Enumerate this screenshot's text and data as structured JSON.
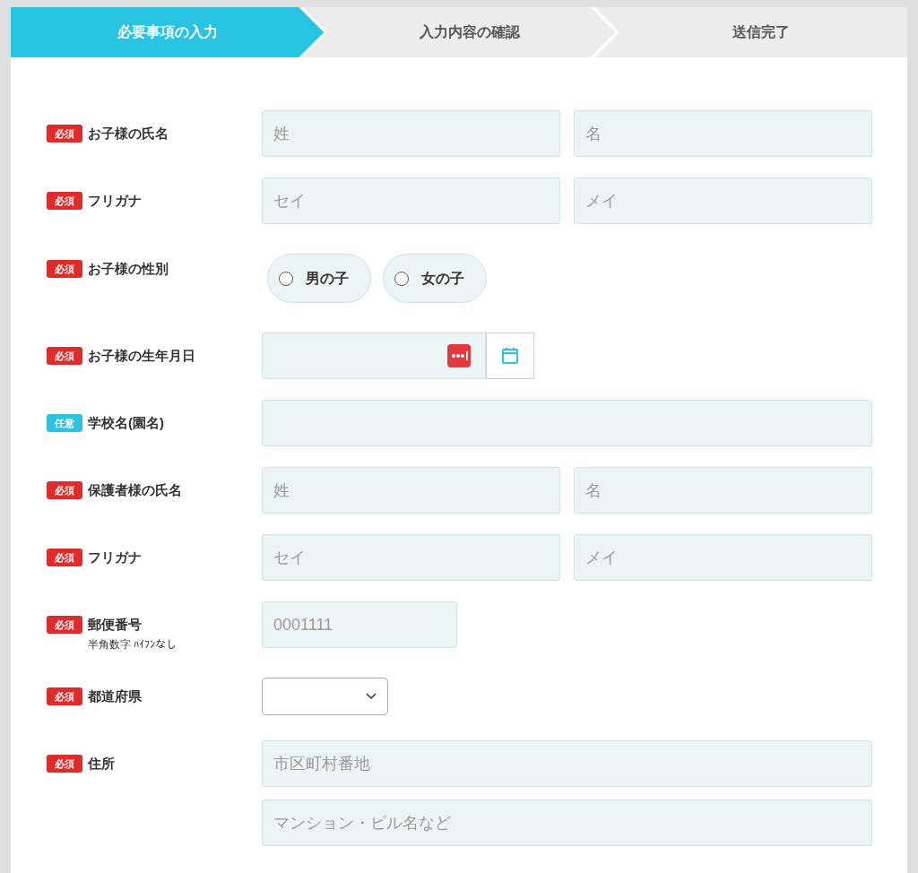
{
  "steps": [
    {
      "label": "必要事項の入力",
      "selected": true
    },
    {
      "label": "入力内容の確認",
      "selected": false
    },
    {
      "label": "送信完了",
      "selected": false
    }
  ],
  "fields": [
    {
      "kind": "pair",
      "badge": {
        "label": "必須",
        "kind": "required"
      },
      "label": "お子様の氏名",
      "inputs": [
        {
          "placeholder": "姓"
        },
        {
          "placeholder": "名"
        }
      ]
    },
    {
      "kind": "pair",
      "badge": {
        "label": "必須",
        "kind": "required"
      },
      "label": "フリガナ",
      "inputs": [
        {
          "placeholder": "セイ"
        },
        {
          "placeholder": "メイ"
        }
      ]
    },
    {
      "kind": "radio",
      "badge": {
        "label": "必須",
        "kind": "required"
      },
      "label": "お子様の性別",
      "options": [
        {
          "label": "男の子",
          "selected": false
        },
        {
          "label": "女の子",
          "selected": false
        }
      ]
    },
    {
      "kind": "date",
      "badge": {
        "label": "必須",
        "kind": "required"
      },
      "label": "お子様の生年月日"
    },
    {
      "kind": "text",
      "badge": {
        "label": "任意",
        "kind": "optional"
      },
      "label": "学校名(園名)"
    },
    {
      "kind": "pair",
      "badge": {
        "label": "必須",
        "kind": "required"
      },
      "label": "保護者様の氏名",
      "inputs": [
        {
          "placeholder": "姓"
        },
        {
          "placeholder": "名"
        }
      ]
    },
    {
      "kind": "pair",
      "badge": {
        "label": "必須",
        "kind": "required"
      },
      "label": "フリガナ",
      "inputs": [
        {
          "placeholder": "セイ"
        },
        {
          "placeholder": "メイ"
        }
      ]
    },
    {
      "kind": "zip",
      "badge": {
        "label": "必須",
        "kind": "required"
      },
      "label": "郵便番号",
      "note": "半角数字 ﾊｲﾌﾝなし",
      "inputs": [
        {
          "placeholder": "0001111"
        }
      ]
    },
    {
      "kind": "select",
      "badge": {
        "label": "必須",
        "kind": "required"
      },
      "label": "都道府県"
    },
    {
      "kind": "stack",
      "badge": {
        "label": "必須",
        "kind": "required"
      },
      "label": "住所",
      "inputs": [
        {
          "placeholder": "市区町村番地"
        },
        {
          "placeholder": "マンション・ビル名など"
        }
      ]
    }
  ]
}
